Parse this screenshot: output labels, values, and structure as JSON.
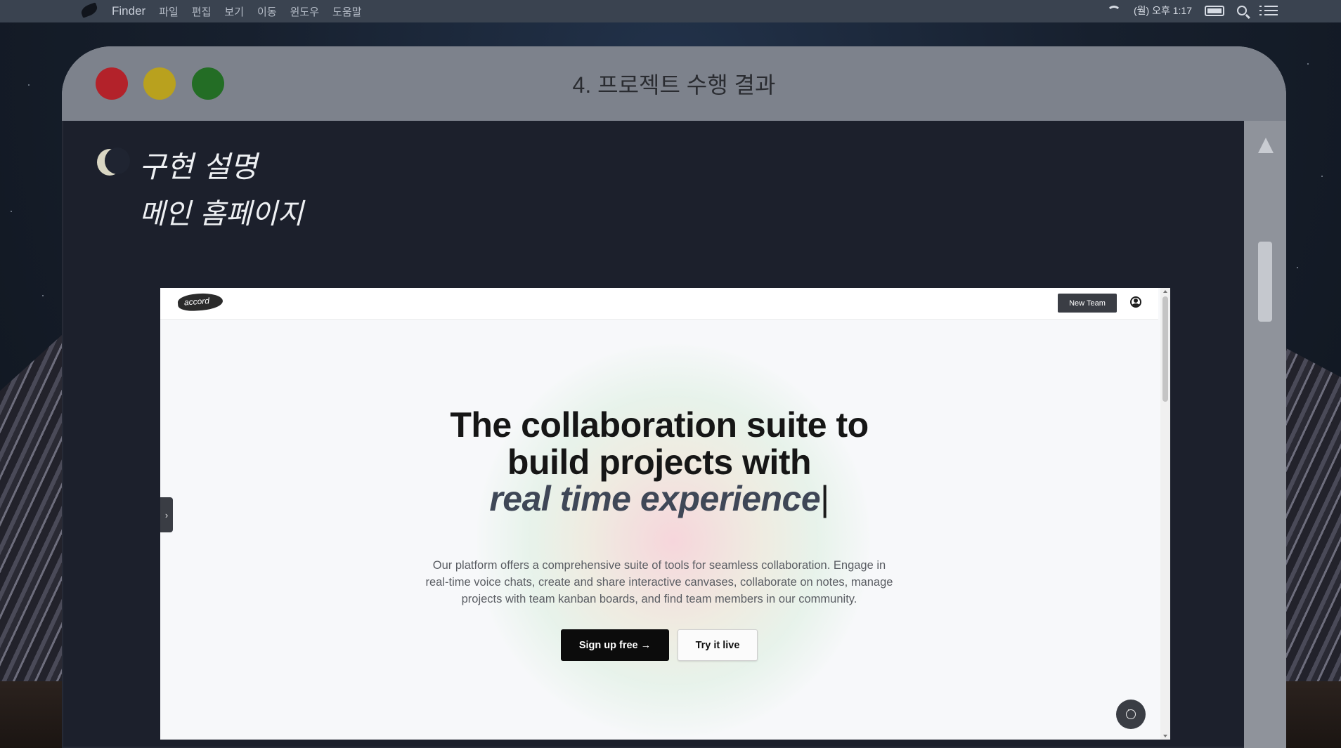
{
  "menubar": {
    "app_name": "Finder",
    "items": [
      "파일",
      "편집",
      "보기",
      "이동",
      "윈도우",
      "도움말"
    ],
    "clock": "(월) 오후 1:17"
  },
  "window": {
    "title": "4. 프로젝트 수행 결과"
  },
  "slide": {
    "heading": "구현 설명",
    "subheading": "메인 홈페이지"
  },
  "webpage": {
    "logo_text": "accord",
    "new_team_label": "New Team",
    "hero_line1": "The collaboration suite to",
    "hero_line2": "build projects with",
    "hero_line3": "real time experience",
    "hero_caret": "|",
    "description": "Our platform offers a comprehensive suite of tools for seamless collaboration. Engage in real-time voice chats, create and share interactive canvases, collaborate on notes, manage projects with team kanban boards, and find team members in our community.",
    "signup_label": "Sign up free →",
    "try_label": "Try it live",
    "sidebar_toggle": "›"
  }
}
